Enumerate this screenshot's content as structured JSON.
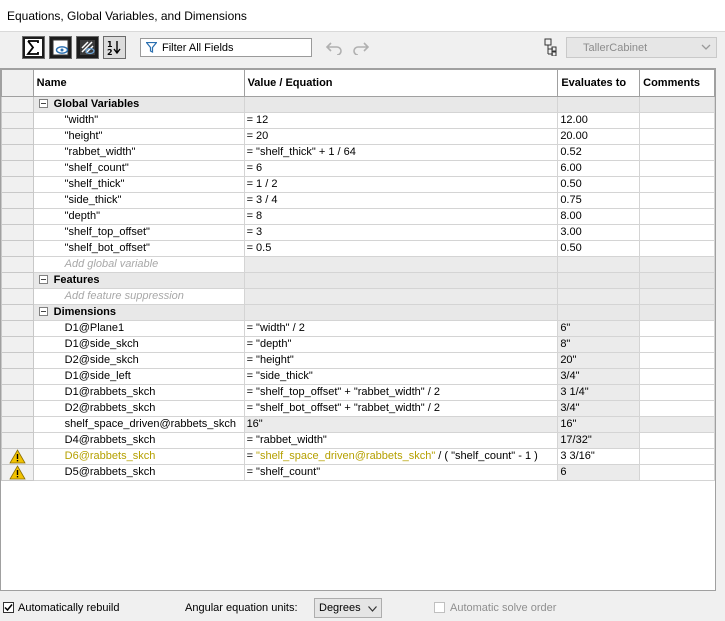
{
  "window": {
    "title": "Equations, Global Variables, and Dimensions"
  },
  "toolbar": {
    "filter_label": "Filter All Fields",
    "configuration": "TallerCabinet",
    "buttons": [
      "sigma-view-icon",
      "eye-view-icon",
      "dimension-view-icon",
      "ordered-view-icon"
    ]
  },
  "columns": [
    "Name",
    "Value / Equation",
    "Evaluates to",
    "Comments"
  ],
  "groups": {
    "global": {
      "label": "Global Variables",
      "add_text": "Add global variable",
      "rows": [
        {
          "name": "\"width\"",
          "value": "= 12",
          "eval": "12.00"
        },
        {
          "name": "\"height\"",
          "value": "= 20",
          "eval": "20.00"
        },
        {
          "name": "\"rabbet_width\"",
          "value": "= \"shelf_thick\" + 1 / 64",
          "eval": "0.52"
        },
        {
          "name": "\"shelf_count\"",
          "value": "= 6",
          "eval": "6.00"
        },
        {
          "name": "\"shelf_thick\"",
          "value": "= 1 / 2",
          "eval": "0.50"
        },
        {
          "name": "\"side_thick\"",
          "value": "= 3 / 4",
          "eval": "0.75"
        },
        {
          "name": "\"depth\"",
          "value": "= 8",
          "eval": "8.00"
        },
        {
          "name": "\"shelf_top_offset\"",
          "value": "= 3",
          "eval": "3.00"
        },
        {
          "name": "\"shelf_bot_offset\"",
          "value": "= 0.5",
          "eval": "0.50"
        }
      ]
    },
    "features": {
      "label": "Features",
      "add_text": "Add feature suppression"
    },
    "dimensions": {
      "label": "Dimensions",
      "rows": [
        {
          "name": "D1@Plane1",
          "value": "= \"width\" / 2",
          "eval": "6\""
        },
        {
          "name": "D1@side_skch",
          "value": "= \"depth\"",
          "eval": "8\""
        },
        {
          "name": "D2@side_skch",
          "value": "= \"height\"",
          "eval": "20\""
        },
        {
          "name": "D1@side_left",
          "value": "= \"side_thick\"",
          "eval": "3/4\""
        },
        {
          "name": "D1@rabbets_skch",
          "value": "= \"shelf_top_offset\" + \"rabbet_width\" / 2",
          "eval": "3 1/4\""
        },
        {
          "name": "D2@rabbets_skch",
          "value": "= \"shelf_bot_offset\" + \"rabbet_width\" / 2",
          "eval": "3/4\""
        },
        {
          "name": "shelf_space_driven@rabbets_skch",
          "value": "16\"",
          "eval": "16\""
        },
        {
          "name": "D4@rabbets_skch",
          "value": "= \"rabbet_width\"",
          "eval": "17/32\""
        },
        {
          "name": "D6@rabbets_skch",
          "value_prefix": "= ",
          "value_hl": "\"shelf_space_driven@rabbets_skch\"",
          "value_suffix": " / ( \"shelf_count\" - 1 )",
          "eval": "3 3/16\"",
          "warning": true
        },
        {
          "name": "D5@rabbets_skch",
          "value": "= \"shelf_count\"",
          "eval": "6",
          "warning": true
        }
      ]
    }
  },
  "footer": {
    "auto_rebuild": "Automatically rebuild",
    "angular_label": "Angular equation units:",
    "angular_value": "Degrees",
    "auto_solve": "Automatic solve order"
  },
  "colors": {
    "warning_text": "#b5a000",
    "warning_icon": "#f2c200"
  }
}
